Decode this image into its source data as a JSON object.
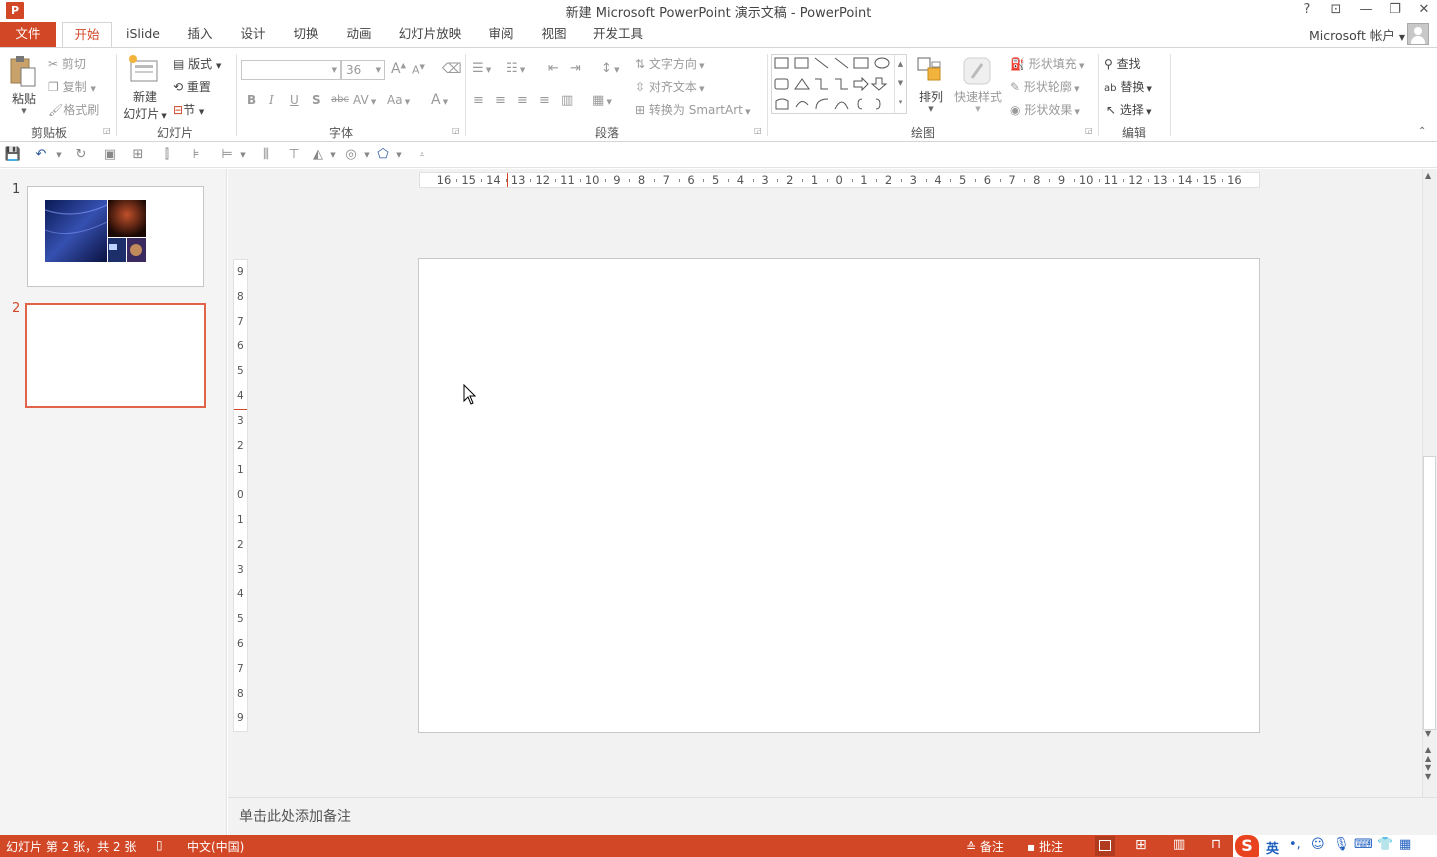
{
  "window": {
    "title": "新建 Microsoft PowerPoint 演示文稿 - PowerPoint",
    "app_icon_label": "P",
    "controls": {
      "help": "?",
      "ribbon_display": "⊡",
      "minimize": "—",
      "restore": "❐",
      "close": "✕"
    }
  },
  "tabs": [
    {
      "label": "文件"
    },
    {
      "label": "开始"
    },
    {
      "label": "iSlide"
    },
    {
      "label": "插入"
    },
    {
      "label": "设计"
    },
    {
      "label": "切换"
    },
    {
      "label": "动画"
    },
    {
      "label": "幻灯片放映"
    },
    {
      "label": "审阅"
    },
    {
      "label": "视图"
    },
    {
      "label": "开发工具"
    }
  ],
  "account": {
    "label": "Microsoft 帐户"
  },
  "ribbon": {
    "clipboard": {
      "paste": "粘贴",
      "cut": "剪切",
      "copy": "复制",
      "format_painter": "格式刷",
      "group_label": "剪贴板"
    },
    "slides": {
      "new_slide_1": "新建",
      "new_slide_2": "幻灯片",
      "layout": "版式",
      "reset": "重置",
      "section": "节",
      "group_label": "幻灯片"
    },
    "font": {
      "font_name": "",
      "font_size": "36",
      "group_label": "字体",
      "bold": "B",
      "italic": "I",
      "underline": "U",
      "shadow": "S",
      "strike": "abc",
      "spacing": "AV",
      "case": "Aa",
      "color": "A",
      "grow": "A",
      "shrink": "A"
    },
    "paragraph": {
      "text_direction": "文字方向",
      "align_text": "对齐文本",
      "convert_smartart": "转换为 SmartArt",
      "group_label": "段落"
    },
    "drawing": {
      "arrange": "排列",
      "quick_styles": "快速样式",
      "shape_fill": "形状填充",
      "shape_outline": "形状轮廓",
      "shape_effects": "形状效果",
      "group_label": "绘图"
    },
    "editing": {
      "find": "查找",
      "replace": "替换",
      "select": "选择",
      "group_label": "编辑"
    }
  },
  "rulers": {
    "horizontal": [
      "16",
      "15",
      "14",
      "13",
      "12",
      "11",
      "10",
      "9",
      "8",
      "7",
      "6",
      "5",
      "4",
      "3",
      "2",
      "1",
      "0",
      "1",
      "2",
      "3",
      "4",
      "5",
      "6",
      "7",
      "8",
      "9",
      "10",
      "11",
      "12",
      "13",
      "14",
      "15",
      "16"
    ],
    "vertical": [
      "9",
      "8",
      "7",
      "6",
      "5",
      "4",
      "3",
      "2",
      "1",
      "0",
      "1",
      "2",
      "3",
      "4",
      "5",
      "6",
      "7",
      "8",
      "9"
    ]
  },
  "thumbnails": [
    {
      "number": "1"
    },
    {
      "number": "2"
    }
  ],
  "notes": {
    "placeholder": "单击此处添加备注"
  },
  "status": {
    "slide_info": "幻灯片 第 2 张，共 2 张",
    "language": "中文(中国)",
    "notes": "备注",
    "comments": "批注",
    "ime_lang": "英"
  },
  "colors": {
    "accent": "#d24726",
    "selected_thumb": "#e0644a"
  }
}
